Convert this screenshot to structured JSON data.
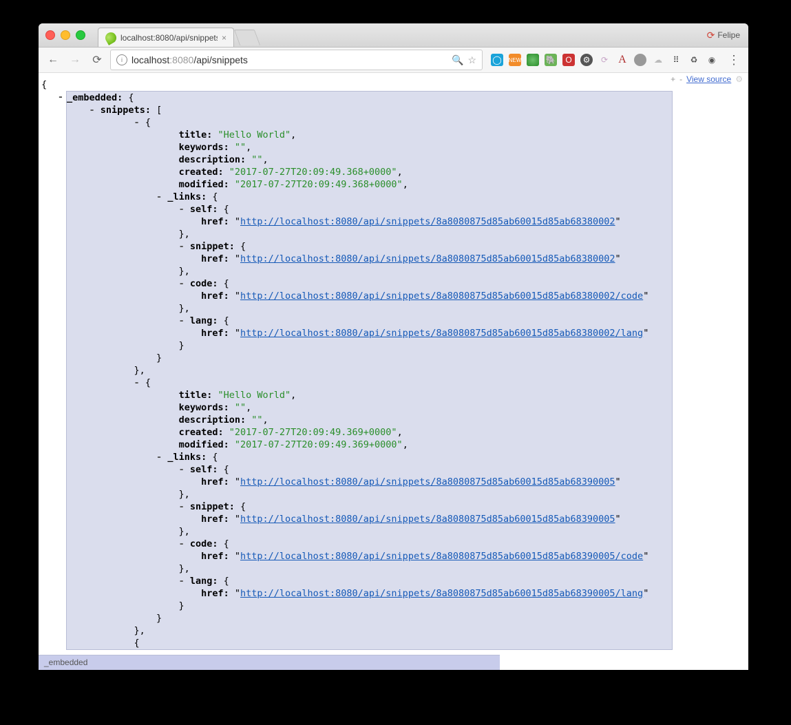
{
  "window": {
    "profile_name": "Felipe",
    "tab_title": "localhost:8080/api/snippets",
    "url_display_host": "localhost",
    "url_display_port": ":8080",
    "url_display_path": "/api/snippets"
  },
  "viewsource": {
    "plus": "+",
    "minus": "-",
    "link": "View source"
  },
  "status_bar": "_embedded",
  "json": {
    "root_key": "_embedded",
    "snippets_key": "snippets",
    "snippets": [
      {
        "title": "Hello World",
        "keywords": "",
        "description": "",
        "created": "2017-07-27T20:09:49.368+0000",
        "modified": "2017-07-27T20:09:49.368+0000",
        "links": {
          "self": "http://localhost:8080/api/snippets/8a8080875d85ab60015d85ab68380002",
          "snippet": "http://localhost:8080/api/snippets/8a8080875d85ab60015d85ab68380002",
          "code": "http://localhost:8080/api/snippets/8a8080875d85ab60015d85ab68380002/code",
          "lang": "http://localhost:8080/api/snippets/8a8080875d85ab60015d85ab68380002/lang"
        }
      },
      {
        "title": "Hello World",
        "keywords": "",
        "description": "",
        "created": "2017-07-27T20:09:49.369+0000",
        "modified": "2017-07-27T20:09:49.369+0000",
        "links": {
          "self": "http://localhost:8080/api/snippets/8a8080875d85ab60015d85ab68390005",
          "snippet": "http://localhost:8080/api/snippets/8a8080875d85ab60015d85ab68390005",
          "code": "http://localhost:8080/api/snippets/8a8080875d85ab60015d85ab68390005/code",
          "lang": "http://localhost:8080/api/snippets/8a8080875d85ab60015d85ab68390005/lang"
        }
      }
    ]
  },
  "labels": {
    "title": "title",
    "keywords": "keywords",
    "description": "description",
    "created": "created",
    "modified": "modified",
    "links": "_links",
    "self": "self",
    "snippet": "snippet",
    "code": "code",
    "lang": "lang",
    "href": "href"
  }
}
